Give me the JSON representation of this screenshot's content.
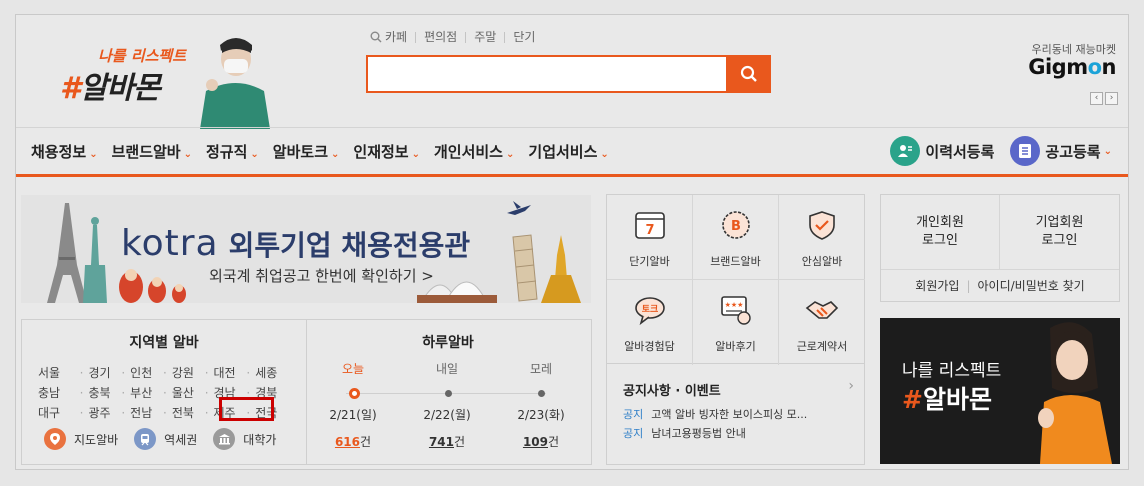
{
  "logo": {
    "tagline": "나를 리스펙트",
    "hash": "#",
    "name": "알바몬"
  },
  "search": {
    "links": [
      "카페",
      "편의점",
      "주말",
      "단기"
    ],
    "placeholder": ""
  },
  "gigmon": {
    "subtitle": "우리동네 재능마켓",
    "logo_prefix": "Gigm",
    "logo_o": "o",
    "logo_suffix": "n"
  },
  "nav": {
    "items": [
      "채용정보",
      "브랜드알바",
      "정규직",
      "알바토크",
      "인재정보",
      "개인서비스",
      "기업서비스"
    ],
    "resume_label": "이력서등록",
    "post_label": "공고등록"
  },
  "banner": {
    "brand": "kotra",
    "headline": "외투기업 채용전용관",
    "subtitle": "외국계 취업공고 한번에 확인하기 >"
  },
  "region": {
    "title": "지역별 알바",
    "rows": [
      [
        "서울",
        "경기",
        "인천",
        "강원",
        "대전",
        "세종"
      ],
      [
        "충남",
        "충북",
        "부산",
        "울산",
        "경남",
        "경북"
      ],
      [
        "대구",
        "광주",
        "전남",
        "전북",
        "제주",
        "전국"
      ]
    ],
    "highlighted": "대전",
    "shortcuts": [
      {
        "label": "지도알바",
        "icon": "map-pin-icon",
        "color": "#e9723f"
      },
      {
        "label": "역세권",
        "icon": "subway-icon",
        "color": "#7c97c7"
      },
      {
        "label": "대학가",
        "icon": "university-icon",
        "color": "#9a9a9a"
      }
    ]
  },
  "daily": {
    "title": "하루알바",
    "days": [
      {
        "label": "오늘",
        "date": "2/21(일)",
        "count": "616",
        "unit": "건"
      },
      {
        "label": "내일",
        "date": "2/22(월)",
        "count": "741",
        "unit": "건"
      },
      {
        "label": "모레",
        "date": "2/23(화)",
        "count": "109",
        "unit": "건"
      }
    ]
  },
  "services": [
    {
      "label": "단기알바",
      "icon": "calendar-7-icon"
    },
    {
      "label": "브랜드알바",
      "icon": "brand-badge-icon"
    },
    {
      "label": "안심알바",
      "icon": "shield-check-icon"
    },
    {
      "label": "알바경험담",
      "icon": "speech-bubble-icon"
    },
    {
      "label": "알바후기",
      "icon": "review-icon"
    },
    {
      "label": "근로계약서",
      "icon": "handshake-icon"
    }
  ],
  "notice": {
    "title": "공지사항 · 이벤트",
    "items": [
      {
        "tag": "공지",
        "text": "고액 알바 빙자한 보이스피싱 모..."
      },
      {
        "tag": "공지",
        "text": "남녀고용평등법 안내"
      }
    ]
  },
  "login": {
    "personal": [
      "개인회원",
      "로그인"
    ],
    "company": [
      "기업회원",
      "로그인"
    ],
    "signup": "회원가입",
    "find": "아이디/비밀번호 찾기"
  },
  "ad": {
    "tagline": "나를 리스펙트",
    "hash": "#",
    "name": "알바몬"
  },
  "colors": {
    "brand": "#e9581d",
    "link": "#2f7fc8",
    "highlight_box": "#cc0000"
  }
}
